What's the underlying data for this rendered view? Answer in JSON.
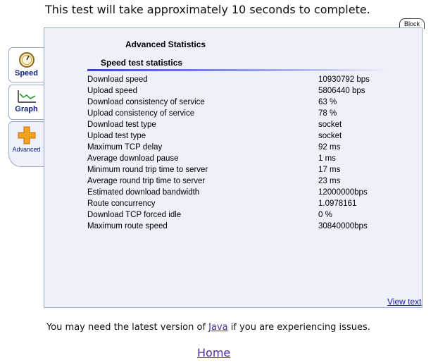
{
  "header": {
    "notice": "This test will take approximately 10 seconds to complete."
  },
  "block_button": "Block",
  "tabs": [
    {
      "label": "Speed",
      "icon": "speedometer-icon"
    },
    {
      "label": "Graph",
      "icon": "line-graph-icon"
    },
    {
      "label": "Advanced",
      "icon": "plus-icon",
      "active": true
    }
  ],
  "panel": {
    "title": "Advanced Statistics",
    "subtitle": "Speed test statistics",
    "stats": [
      {
        "label": "Download speed",
        "value": "10930792 bps"
      },
      {
        "label": "Upload speed",
        "value": "5806440 bps"
      },
      {
        "label": "Download consistency of service",
        "value": "63 %"
      },
      {
        "label": "Upload consistency of service",
        "value": "78 %"
      },
      {
        "label": "Download test type",
        "value": "socket"
      },
      {
        "label": "Upload test type",
        "value": "socket"
      },
      {
        "label": "Maximum TCP delay",
        "value": "92 ms"
      },
      {
        "label": "Average download pause",
        "value": "1 ms"
      },
      {
        "label": "Minimum round trip time to server",
        "value": "17 ms"
      },
      {
        "label": "Average round trip time to server",
        "value": "23 ms"
      },
      {
        "label": "Estimated download bandwidth",
        "value": "12000000bps"
      },
      {
        "label": "Route concurrency",
        "value": "1.0978161"
      },
      {
        "label": "Download TCP forced idle",
        "value": "0 %"
      },
      {
        "label": "Maximum route speed",
        "value": "30840000bps"
      }
    ],
    "view_text_link": "View text"
  },
  "footer": {
    "java_prefix": "You may need the latest version of ",
    "java_link": "Java",
    "java_suffix": " if you are experiencing issues.",
    "home_link": "Home"
  },
  "colors": {
    "panel_bg": "#eef0fa",
    "tab_label": "#0b1e7a",
    "link": "#4b2ba0"
  }
}
